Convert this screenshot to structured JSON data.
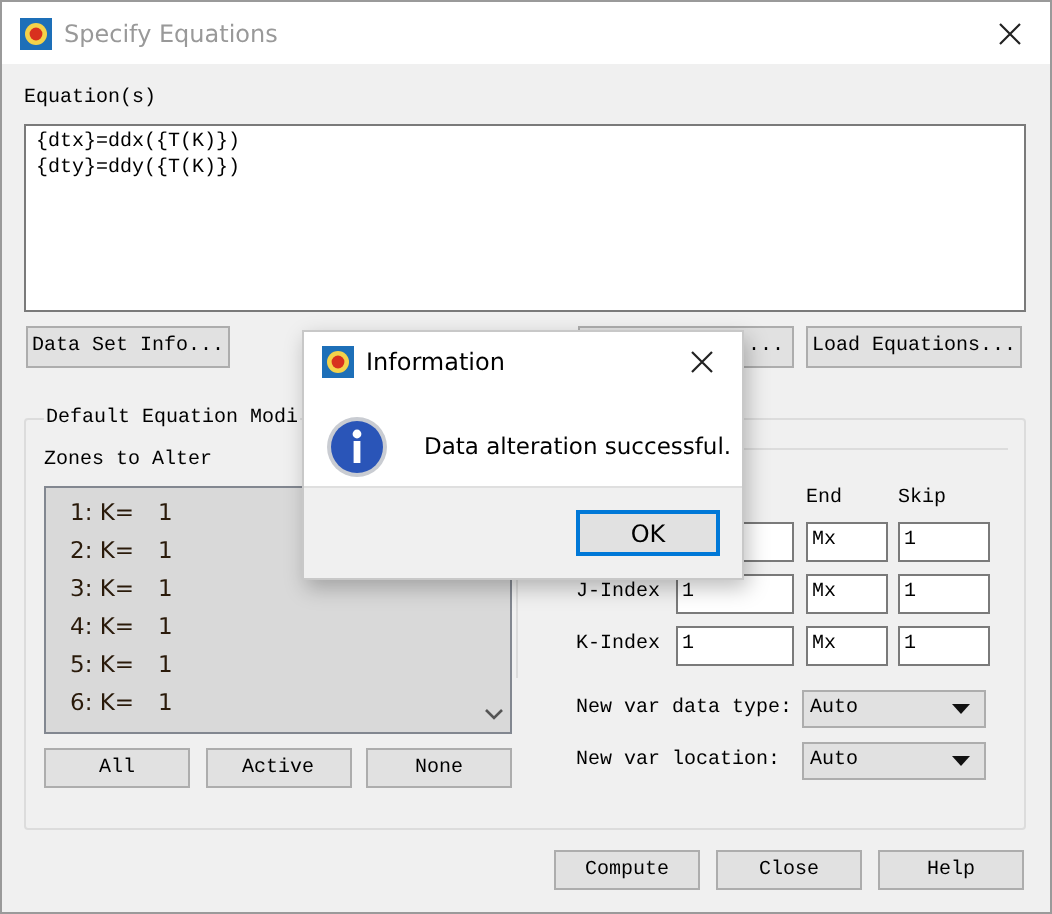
{
  "window": {
    "title": "Specify Equations"
  },
  "equations": {
    "label": "Equation(s)",
    "lines": [
      "{dtx}=ddx({T(K)})",
      "{dty}=ddy({T(K)})"
    ]
  },
  "equation_buttons": [
    "Data Set Info...",
    "...",
    "Load Equations..."
  ],
  "modifiers": {
    "title": "Default Equation Modi",
    "zones_label": "Zones to Alter",
    "zones": [
      {
        "zone": "1: K=",
        "value": "1"
      },
      {
        "zone": "2: K=",
        "value": "1"
      },
      {
        "zone": "3: K=",
        "value": "1"
      },
      {
        "zone": "4: K=",
        "value": "1"
      },
      {
        "zone": "5: K=",
        "value": "1"
      },
      {
        "zone": "6: K=",
        "value": "1"
      }
    ],
    "zone_buttons": [
      "All",
      "Active",
      "None"
    ],
    "index_headers": [
      "End",
      "Skip"
    ],
    "index_rows": [
      {
        "end": "Mx",
        "skip": "1"
      },
      {
        "label": "J-Index",
        "begin": "1",
        "end": "Mx",
        "skip": "1"
      },
      {
        "label": "K-Index",
        "begin": "1",
        "end": "Mx",
        "skip": "1"
      }
    ],
    "dropdowns": [
      {
        "label": "New var data type:",
        "value": "Auto"
      },
      {
        "label": "New var location:",
        "value": "Auto"
      }
    ]
  },
  "buttons": [
    "Compute",
    "Close",
    "Help"
  ],
  "dialog": {
    "title": "Information",
    "message": "Data alteration successful.",
    "button": "OK"
  }
}
